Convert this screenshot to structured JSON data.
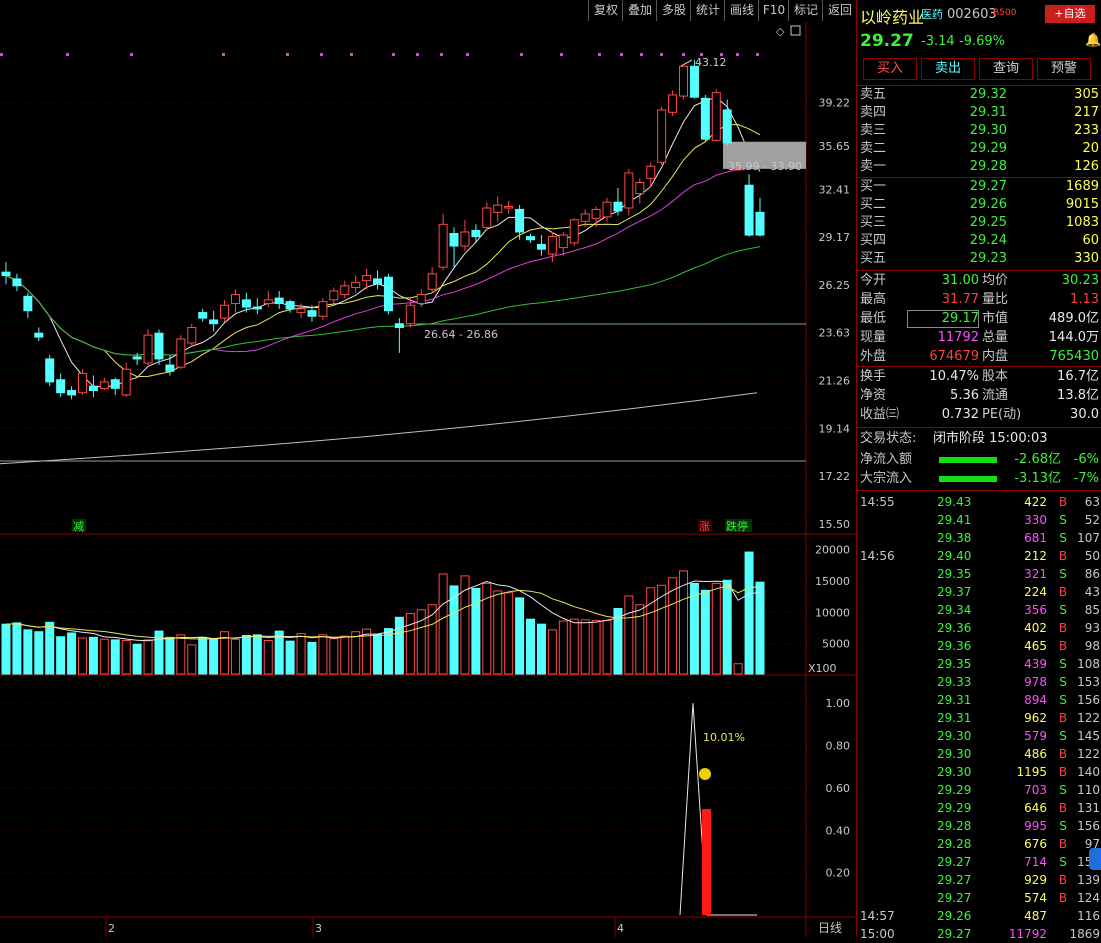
{
  "toolbar": {
    "buttons": [
      "复权",
      "叠加",
      "多股",
      "统计",
      "画线",
      "F10",
      "标记",
      "返回"
    ]
  },
  "stock": {
    "name": "以岭药业",
    "tag": "医药",
    "code": "002603",
    "rank": "R500",
    "add_fav": "+自选",
    "price": "29.27",
    "change": "-3.14",
    "pct": "-9.69%"
  },
  "actions": [
    "买入",
    "卖出",
    "查询",
    "预警"
  ],
  "orderbook": {
    "asks": [
      {
        "label": "卖五",
        "price": "29.32",
        "vol": "305"
      },
      {
        "label": "卖四",
        "price": "29.31",
        "vol": "217"
      },
      {
        "label": "卖三",
        "price": "29.30",
        "vol": "233"
      },
      {
        "label": "卖二",
        "price": "29.29",
        "vol": "20"
      },
      {
        "label": "卖一",
        "price": "29.28",
        "vol": "126"
      }
    ],
    "bids": [
      {
        "label": "买一",
        "price": "29.27",
        "vol": "1689"
      },
      {
        "label": "买二",
        "price": "29.26",
        "vol": "9015"
      },
      {
        "label": "买三",
        "price": "29.25",
        "vol": "1083"
      },
      {
        "label": "买四",
        "price": "29.24",
        "vol": "60"
      },
      {
        "label": "买五",
        "price": "29.23",
        "vol": "330"
      }
    ]
  },
  "stats1": [
    {
      "l1": "今开",
      "v1": "31.00",
      "l2": "均价",
      "v2": "30.23"
    },
    {
      "l1": "最高",
      "v1": "31.77",
      "l2": "量比",
      "v2": "1.13"
    },
    {
      "l1": "最低",
      "v1": "29.17",
      "l2": "市值",
      "v2": "489.0亿"
    },
    {
      "l1": "现量",
      "v1": "11792",
      "l2": "总量",
      "v2": "144.0万"
    },
    {
      "l1": "外盘",
      "v1": "674679",
      "l2": "内盘",
      "v2": "765430"
    }
  ],
  "stats2": [
    {
      "l1": "换手",
      "v1": "10.47%",
      "l2": "股本",
      "v2": "16.7亿"
    },
    {
      "l1": "净资",
      "v1": "5.36",
      "l2": "流通",
      "v2": "13.8亿"
    },
    {
      "l1": "收益㈢",
      "v1": "0.732",
      "l2": "PE(动)",
      "v2": "30.0"
    }
  ],
  "status": {
    "label": "交易状态:",
    "value": "闭市阶段 15:00:03"
  },
  "flows": [
    {
      "label": "净流入额",
      "value": "-2.68亿",
      "pct": "-6%"
    },
    {
      "label": "大宗流入",
      "value": "-3.13亿",
      "pct": "-7%"
    }
  ],
  "ticks": [
    {
      "time": "14:55",
      "price": "29.43",
      "vol": "422",
      "bs": "B",
      "cnt": "63"
    },
    {
      "time": "",
      "price": "29.41",
      "vol": "330",
      "bs": "S",
      "cnt": "52"
    },
    {
      "time": "",
      "price": "29.38",
      "vol": "681",
      "bs": "S",
      "cnt": "107"
    },
    {
      "time": "14:56",
      "price": "29.40",
      "vol": "212",
      "bs": "B",
      "cnt": "50"
    },
    {
      "time": "",
      "price": "29.35",
      "vol": "321",
      "bs": "S",
      "cnt": "86"
    },
    {
      "time": "",
      "price": "29.37",
      "vol": "224",
      "bs": "B",
      "cnt": "43"
    },
    {
      "time": "",
      "price": "29.34",
      "vol": "356",
      "bs": "S",
      "cnt": "85"
    },
    {
      "time": "",
      "price": "29.36",
      "vol": "402",
      "bs": "B",
      "cnt": "93"
    },
    {
      "time": "",
      "price": "29.36",
      "vol": "465",
      "bs": "B",
      "cnt": "98"
    },
    {
      "time": "",
      "price": "29.35",
      "vol": "439",
      "bs": "S",
      "cnt": "108"
    },
    {
      "time": "",
      "price": "29.33",
      "vol": "978",
      "bs": "S",
      "cnt": "153"
    },
    {
      "time": "",
      "price": "29.31",
      "vol": "894",
      "bs": "S",
      "cnt": "156"
    },
    {
      "time": "",
      "price": "29.31",
      "vol": "962",
      "bs": "B",
      "cnt": "122"
    },
    {
      "time": "",
      "price": "29.30",
      "vol": "579",
      "bs": "S",
      "cnt": "145"
    },
    {
      "time": "",
      "price": "29.30",
      "vol": "486",
      "bs": "B",
      "cnt": "122"
    },
    {
      "time": "",
      "price": "29.30",
      "vol": "1195",
      "bs": "B",
      "cnt": "140"
    },
    {
      "time": "",
      "price": "29.29",
      "vol": "703",
      "bs": "S",
      "cnt": "110"
    },
    {
      "time": "",
      "price": "29.29",
      "vol": "646",
      "bs": "B",
      "cnt": "131"
    },
    {
      "time": "",
      "price": "29.28",
      "vol": "995",
      "bs": "S",
      "cnt": "156"
    },
    {
      "time": "",
      "price": "29.28",
      "vol": "676",
      "bs": "B",
      "cnt": "97"
    },
    {
      "time": "",
      "price": "29.27",
      "vol": "714",
      "bs": "S",
      "cnt": "156"
    },
    {
      "time": "",
      "price": "29.27",
      "vol": "929",
      "bs": "B",
      "cnt": "139"
    },
    {
      "time": "",
      "price": "29.27",
      "vol": "574",
      "bs": "B",
      "cnt": "124"
    },
    {
      "time": "14:57",
      "price": "29.26",
      "vol": "487",
      "bs": "",
      "cnt": "116"
    },
    {
      "time": "15:00",
      "price": "29.27",
      "vol": "11792",
      "bs": "",
      "cnt": "1869"
    }
  ],
  "chart_data": {
    "type": "candlestick",
    "price_axis": [
      "39.22",
      "35.65",
      "32.41",
      "29.17",
      "26.25",
      "23.63",
      "21.26",
      "19.14",
      "17.22",
      "15.50"
    ],
    "volume_axis": [
      "20000",
      "15000",
      "10000",
      "5000"
    ],
    "volume_unit": "X100",
    "indicator_axis": [
      "1.00",
      "0.80",
      "0.60",
      "0.40",
      "0.20"
    ],
    "x_labels": [
      "2",
      "3",
      "4"
    ],
    "period_label": "日线",
    "annotations": {
      "high": "43.12",
      "gap": "35.99 - 33.90",
      "gap2": "26.64 - 26.86",
      "indicator_pct": "10.01%",
      "marker_left": "减",
      "marker_up": "涨",
      "marker_limit": "跌停"
    },
    "candles": [
      [
        27.0,
        27.6,
        26.3,
        26.8
      ],
      [
        26.6,
        26.9,
        25.9,
        26.2
      ],
      [
        25.6,
        25.8,
        24.4,
        24.8
      ],
      [
        23.6,
        23.9,
        23.2,
        23.4
      ],
      [
        22.3,
        22.5,
        21.0,
        21.2
      ],
      [
        21.3,
        21.6,
        20.5,
        20.7
      ],
      [
        20.8,
        21.0,
        20.4,
        20.6
      ],
      [
        20.7,
        21.8,
        20.6,
        21.6
      ],
      [
        21.0,
        21.5,
        20.5,
        20.8
      ],
      [
        20.9,
        21.4,
        20.8,
        21.2
      ],
      [
        21.3,
        21.4,
        20.6,
        20.9
      ],
      [
        20.6,
        22.1,
        20.5,
        21.8
      ],
      [
        22.4,
        22.6,
        22.0,
        22.3
      ],
      [
        22.1,
        23.8,
        22.0,
        23.5
      ],
      [
        23.6,
        23.8,
        22.0,
        22.3
      ],
      [
        22.0,
        22.5,
        21.5,
        21.7
      ],
      [
        21.9,
        23.5,
        21.8,
        23.3
      ],
      [
        23.1,
        24.1,
        22.9,
        23.9
      ],
      [
        24.7,
        24.9,
        24.2,
        24.4
      ],
      [
        24.3,
        24.8,
        23.7,
        24.1
      ],
      [
        24.4,
        25.4,
        24.2,
        25.1
      ],
      [
        25.2,
        26.0,
        24.7,
        25.7
      ],
      [
        25.4,
        25.8,
        24.7,
        25.0
      ],
      [
        25.0,
        25.5,
        24.6,
        24.9
      ],
      [
        25.2,
        25.9,
        25.0,
        25.4
      ],
      [
        25.5,
        25.9,
        24.9,
        25.2
      ],
      [
        25.3,
        25.4,
        24.7,
        24.9
      ],
      [
        24.7,
        25.2,
        24.4,
        24.9
      ],
      [
        24.8,
        25.1,
        24.2,
        24.5
      ],
      [
        24.5,
        25.5,
        24.3,
        25.3
      ],
      [
        25.4,
        26.1,
        25.2,
        25.9
      ],
      [
        25.7,
        26.5,
        25.5,
        26.2
      ],
      [
        26.1,
        26.8,
        25.8,
        26.4
      ],
      [
        26.5,
        27.2,
        26.0,
        26.8
      ],
      [
        26.6,
        27.1,
        26.0,
        26.3
      ],
      [
        26.7,
        26.9,
        24.6,
        24.8
      ],
      [
        24.1,
        24.4,
        22.6,
        23.9
      ],
      [
        24.1,
        25.5,
        23.9,
        25.1
      ],
      [
        25.2,
        26.0,
        25.0,
        25.7
      ],
      [
        26.0,
        27.3,
        25.8,
        26.9
      ],
      [
        27.3,
        30.7,
        27.1,
        30.0
      ],
      [
        29.4,
        29.8,
        27.3,
        28.6
      ],
      [
        28.6,
        30.3,
        28.3,
        29.5
      ],
      [
        29.6,
        30.0,
        28.8,
        29.2
      ],
      [
        29.8,
        31.5,
        29.6,
        31.1
      ],
      [
        30.8,
        31.9,
        30.2,
        31.3
      ],
      [
        31.1,
        31.6,
        30.7,
        31.2
      ],
      [
        31.0,
        31.3,
        29.0,
        29.5
      ],
      [
        29.2,
        29.4,
        28.8,
        29.0
      ],
      [
        28.7,
        29.3,
        28.0,
        28.4
      ],
      [
        28.1,
        29.5,
        27.6,
        29.2
      ],
      [
        28.5,
        29.5,
        28.0,
        29.3
      ],
      [
        28.8,
        30.4,
        28.6,
        30.3
      ],
      [
        30.2,
        31.0,
        29.8,
        30.7
      ],
      [
        30.4,
        31.2,
        29.8,
        31.0
      ],
      [
        30.5,
        31.8,
        30.2,
        31.5
      ],
      [
        31.5,
        32.5,
        30.6,
        30.9
      ],
      [
        31.1,
        33.9,
        30.6,
        33.6
      ],
      [
        32.1,
        33.2,
        31.4,
        32.9
      ],
      [
        33.2,
        34.4,
        32.6,
        34.1
      ],
      [
        34.4,
        38.9,
        34.2,
        38.6
      ],
      [
        38.4,
        40.3,
        38.1,
        39.9
      ],
      [
        39.8,
        42.5,
        39.5,
        42.5
      ],
      [
        42.5,
        43.1,
        39.6,
        39.7
      ],
      [
        39.6,
        39.9,
        36.0,
        36.2
      ],
      [
        36.1,
        40.4,
        36.0,
        40.1
      ],
      [
        38.6,
        39.5,
        35.7,
        35.9
      ],
      [
        33.9,
        33.9,
        33.9,
        33.9
      ],
      [
        32.7,
        33.5,
        29.2,
        29.3
      ],
      [
        30.8,
        31.8,
        29.2,
        29.3
      ]
    ],
    "volumes": [
      8100,
      8300,
      7200,
      6900,
      8400,
      6100,
      6700,
      5900,
      6000,
      5700,
      5600,
      5500,
      4900,
      5600,
      7000,
      6000,
      6400,
      4800,
      6000,
      5800,
      6900,
      5700,
      6300,
      6400,
      5500,
      7000,
      5400,
      6600,
      5200,
      6400,
      5800,
      6200,
      6900,
      7300,
      6500,
      7400,
      9200,
      9800,
      10400,
      11200,
      16100,
      14200,
      15800,
      13800,
      14600,
      13400,
      13100,
      12300,
      8900,
      8100,
      7200,
      8600,
      8900,
      8800,
      8700,
      8700,
      10600,
      12600,
      11200,
      13900,
      14300,
      15500,
      16600,
      14600,
      13500,
      14600,
      15100,
      1800,
      19600,
      14800
    ],
    "ma_lines": {
      "ma5": "yellow-white",
      "ma10": "yellow",
      "ma20": "magenta",
      "ma60": "green",
      "ma120": "gray"
    }
  }
}
